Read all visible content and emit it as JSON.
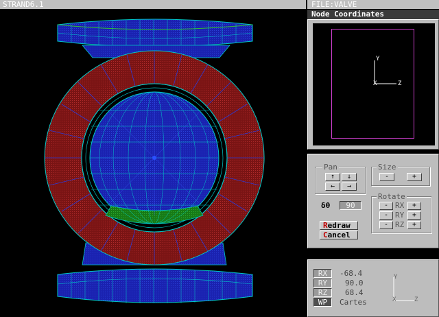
{
  "app": {
    "title": "STRAND6.1",
    "file": "FILE:VALVE"
  },
  "panel": {
    "title": "Node Coordinates"
  },
  "preview_axes": {
    "y": "Y",
    "x": "X",
    "z": "Z"
  },
  "pan": {
    "label": "Pan",
    "up": "↑",
    "down": "↓",
    "left": "←",
    "right": "→"
  },
  "size": {
    "label": "Size",
    "minus": "-",
    "plus": "+"
  },
  "rotate": {
    "label": "Rotate",
    "rows": [
      {
        "minus": "-",
        "axis": "RX",
        "plus": "+"
      },
      {
        "minus": "-",
        "axis": "RY",
        "plus": "+"
      },
      {
        "minus": "-",
        "axis": "RZ",
        "plus": "+"
      }
    ]
  },
  "delta": {
    "label": "δθ",
    "value": "90"
  },
  "actions": {
    "redraw_hot": "R",
    "redraw_rest": "edraw",
    "cancel_hot": "C",
    "cancel_rest": "ancel"
  },
  "status": {
    "rx_label": "RX",
    "rx_value": "-68.4",
    "ry_label": "RY",
    "ry_value": "90.0",
    "rz_label": "RZ",
    "rz_value": "68.4",
    "wp_label": "WP",
    "wp_value": "Cartes"
  },
  "status_axes": {
    "y": "Y",
    "x": "X",
    "z": "Z"
  },
  "colors": {
    "mesh_blue": "#1a22b8",
    "mesh_line": "#00c8c8",
    "flange_red": "#8a1a1a",
    "seat_green": "#1c8c1c",
    "frame_magenta": "#d040d0"
  }
}
